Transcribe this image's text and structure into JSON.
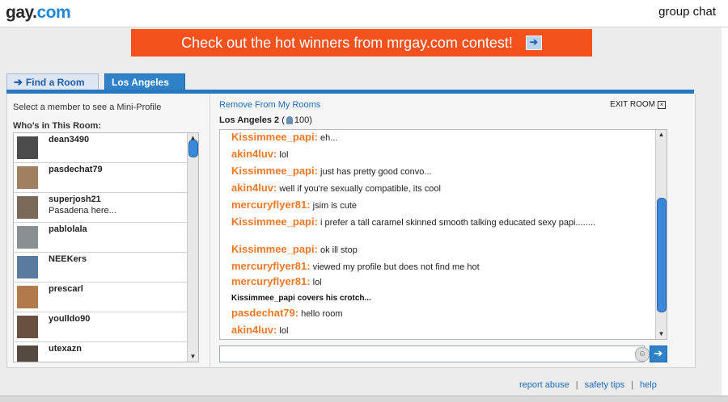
{
  "header": {
    "logo_part1": "gay.",
    "logo_part2": "com",
    "right_text": "group chat"
  },
  "banner": {
    "text": "Check out the hot winners from mrgay.com contest!",
    "arrow_icon": "arrow-right-icon"
  },
  "tabs": [
    {
      "label": "Find a Room",
      "icon": "arrow-right-icon"
    },
    {
      "label": "Los Angeles",
      "close": "⊠"
    }
  ],
  "left": {
    "hint": "Select a member to see a Mini-Profile",
    "heading": "Who's in This Room:",
    "members": [
      {
        "name": "dean3490",
        "sub": ""
      },
      {
        "name": "pasdechat79",
        "sub": ""
      },
      {
        "name": "superjosh21",
        "sub": "Pasadena here..."
      },
      {
        "name": "pablolala",
        "sub": ""
      },
      {
        "name": "NEEKers",
        "sub": ""
      },
      {
        "name": "prescarl",
        "sub": ""
      },
      {
        "name": "youlldo90",
        "sub": ""
      },
      {
        "name": "utexazn",
        "sub": ""
      }
    ]
  },
  "right": {
    "remove_link": "Remove From My Rooms",
    "exit": "EXIT ROOM",
    "room_name": "Los Angeles 2",
    "room_count_prefix": "(",
    "room_count": "100)",
    "messages": [
      {
        "nick": "Kissimmee_papi:",
        "text": " eh..."
      },
      {
        "nick": "akin4luv:",
        "text": " lol"
      },
      {
        "nick": "Kissimmee_papi:",
        "text": " just has pretty good convo..."
      },
      {
        "nick": "akin4luv:",
        "text": " well if you're sexually compatible, its cool"
      },
      {
        "nick": "mercuryflyer81:",
        "text": " jsim is cute"
      },
      {
        "nick": "Kissimmee_papi:",
        "text": " i prefer a tall caramel skinned smooth talking educated sexy papi........"
      },
      {
        "nick": "Kissimmee_papi:",
        "text": " ok ill stop"
      },
      {
        "nick": "mercuryflyer81:",
        "text": " viewed my profile but does not find me hot"
      },
      {
        "nick": "mercuryflyer81:",
        "text": " lol"
      },
      {
        "action": "Kissimmee_papi covers his crotch..."
      },
      {
        "nick": "pasdechat79:",
        "text": " hello room"
      },
      {
        "nick": "akin4luv:",
        "text": " lol"
      }
    ]
  },
  "footer": {
    "report": "report abuse",
    "safety": "safety tips",
    "help": "help",
    "sep": "|"
  },
  "colors": {
    "banner": "#f5511d",
    "accent_blue": "#2878c0",
    "nick_orange": "#ef7825"
  }
}
